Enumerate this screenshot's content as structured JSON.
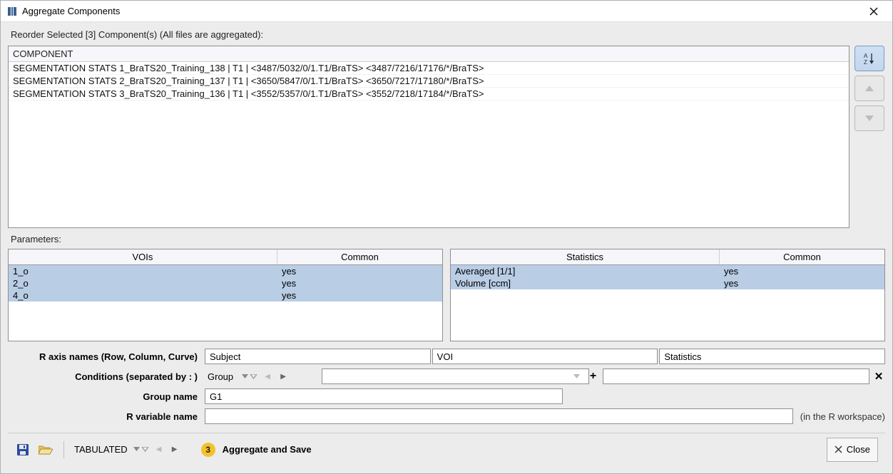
{
  "window": {
    "title": "Aggregate Components"
  },
  "reorder_label": "Reorder Selected [3] Component(s) (All files are aggregated):",
  "component_header": "COMPONENT",
  "components": [
    "SEGMENTATION STATS 1_BraTS20_Training_138 | T1 |   <3487/5032/0/1.T1/BraTS>   <3487/7216/17176/*/BraTS>",
    "SEGMENTATION STATS 2_BraTS20_Training_137 | T1 |   <3650/5847/0/1.T1/BraTS>   <3650/7217/17180/*/BraTS>",
    "SEGMENTATION STATS 3_BraTS20_Training_136 | T1 |   <3552/5357/0/1.T1/BraTS>   <3552/7218/17184/*/BraTS>"
  ],
  "parameters_label": "Parameters:",
  "vois_table": {
    "headers": [
      "VOIs",
      "Common"
    ],
    "rows": [
      {
        "name": "1_o",
        "common": "yes"
      },
      {
        "name": "2_o",
        "common": "yes"
      },
      {
        "name": "4_o",
        "common": "yes"
      }
    ]
  },
  "stats_table": {
    "headers": [
      "Statistics",
      "Common"
    ],
    "rows": [
      {
        "name": "Averaged [1/1]",
        "common": "yes"
      },
      {
        "name": "Volume [ccm]",
        "common": "yes"
      }
    ]
  },
  "axis_label": "R axis names (Row, Column, Curve)",
  "axis_row": "Subject",
  "axis_col": "VOI",
  "axis_curve": "Statistics",
  "conditions_label": "Conditions (separated by : )",
  "conditions_combo": "Group",
  "conditions_value": "",
  "conditions_extra": "",
  "group_name_label": "Group name",
  "group_name_value": "G1",
  "rvar_label": "R variable name",
  "rvar_value": "",
  "rvar_hint": "(in the R workspace)",
  "output_format": "TABULATED",
  "badge_number": "3",
  "aggregate_label": "Aggregate and Save",
  "close_label": "Close"
}
